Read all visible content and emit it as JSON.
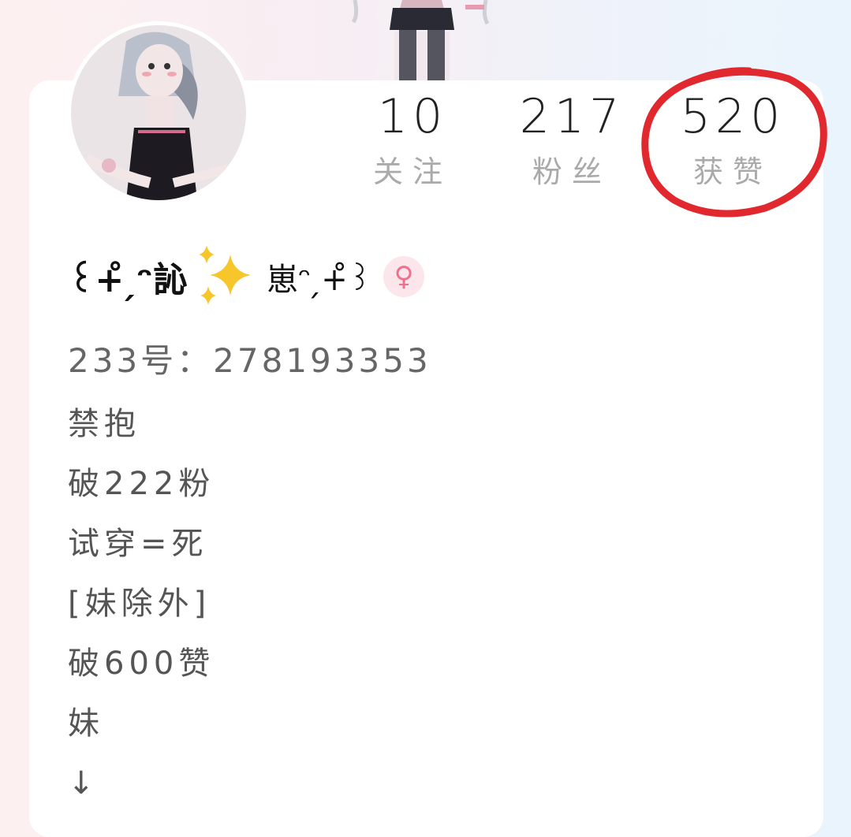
{
  "stats": {
    "follow": {
      "count": "10",
      "label": "关注"
    },
    "fans": {
      "count": "217",
      "label": "粉丝"
    },
    "likes": {
      "count": "520",
      "label": "获赞"
    }
  },
  "profile": {
    "name_part1": "꒰+̊ ̗ᵔ訫",
    "name_part2": "崽ᵔ ̗+̊꒱",
    "gender_symbol": "♀",
    "uid": "233号：278193353"
  },
  "bio_lines": [
    "禁抱",
    "破222粉",
    "试穿=死",
    "[妹除外]",
    "破600赞",
    "妹",
    "↓"
  ],
  "colors": {
    "highlight_circle": "#e0282e",
    "gender_badge_bg": "#fde5ec",
    "gender_badge_fg": "#f0708c"
  },
  "icons": {
    "sparkles": "sparkles-icon",
    "gender": "female-icon"
  }
}
